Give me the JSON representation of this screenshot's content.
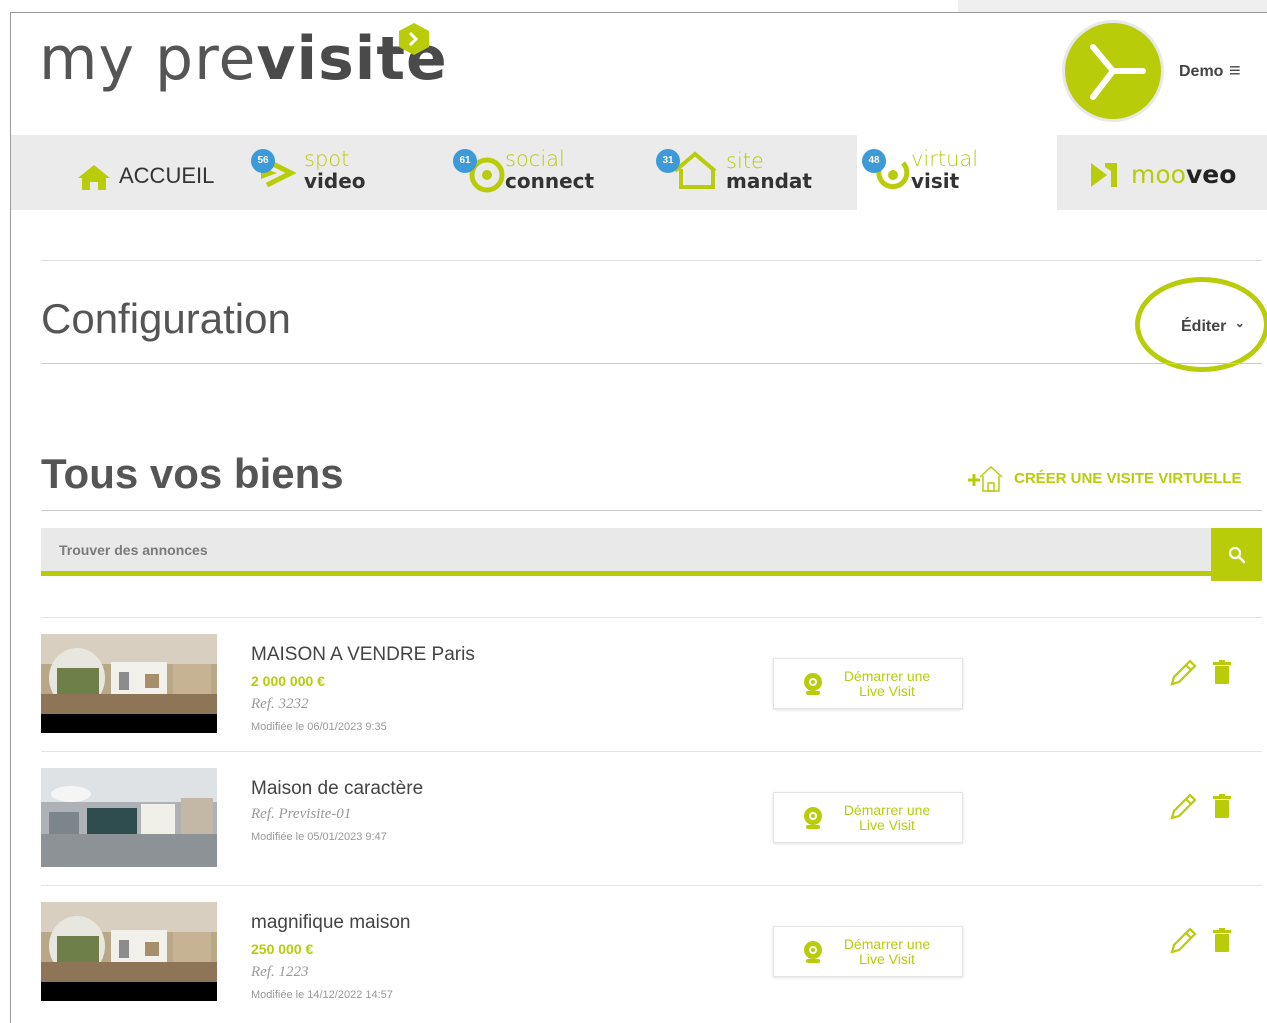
{
  "header": {
    "logo_light": "my pre",
    "logo_bold": "visite",
    "user_name": "Demo",
    "menu_glyph": "≡"
  },
  "nav": {
    "home_label": "ACCUEIL",
    "items": [
      {
        "badge": "56",
        "line1": "spot",
        "line2": "video"
      },
      {
        "badge": "61",
        "line1": "social",
        "line2": "connect"
      },
      {
        "badge": "31",
        "line1": "site",
        "line2": "mandat"
      },
      {
        "badge": "48",
        "line1": "virtual",
        "line2": "visit"
      }
    ],
    "mooveo_light": "moo",
    "mooveo_bold": "veo",
    "active": "virtual visit"
  },
  "configuration": {
    "title": "Configuration",
    "edit_label": "Éditer",
    "edit_chevron": "⌄"
  },
  "properties": {
    "title": "Tous vos biens",
    "create_label": "CRÉER UNE VISITE VIRTUELLE",
    "search_placeholder": "Trouver des annonces",
    "items": [
      {
        "title": "MAISON A VENDRE Paris",
        "price": "2 000 000 €",
        "ref": "Ref. 3232",
        "modified": "Modifiée le 06/01/2023 9:35",
        "live_label": "Démarrer une Live Visit"
      },
      {
        "title": "Maison de caractère",
        "price": "",
        "ref": "Ref. Previsite-01",
        "modified": "Modifiée le 05/01/2023 9:47",
        "live_label": "Démarrer une Live Visit"
      },
      {
        "title": "magnifique maison",
        "price": "250 000 €",
        "ref": "Ref. 1223",
        "modified": "Modifiée le 14/12/2022 14:57",
        "live_label": "Démarrer une Live Visit"
      }
    ]
  },
  "colors": {
    "accent": "#b8cc0a",
    "badge": "#3c9ad8",
    "nav_bg": "#ebebeb"
  }
}
